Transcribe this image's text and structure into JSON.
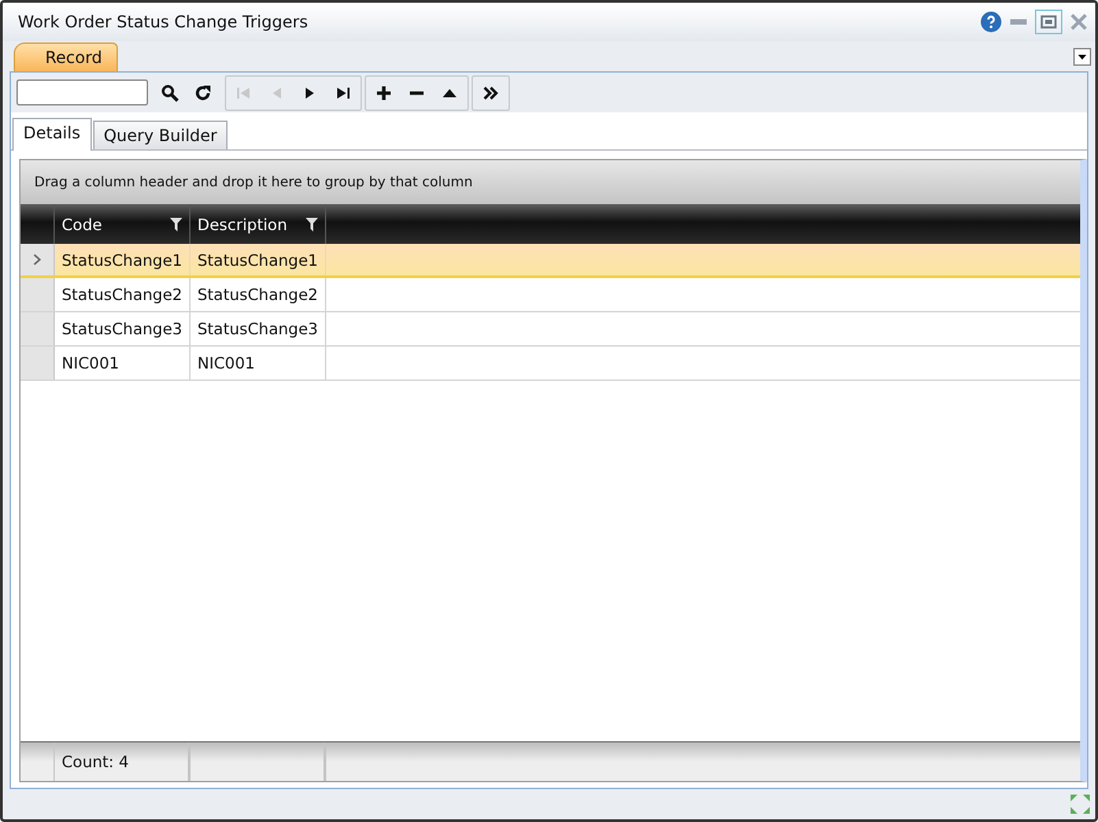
{
  "window": {
    "title": "Work Order Status Change Triggers"
  },
  "ribbon_tabs": [
    {
      "label": "Record",
      "selected": true
    }
  ],
  "toolbar": {
    "buttons": [
      {
        "kind": "search",
        "disabled": false
      },
      {
        "kind": "refresh",
        "disabled": false
      },
      {
        "kind": "first",
        "disabled": true
      },
      {
        "kind": "prev",
        "disabled": true
      },
      {
        "kind": "next",
        "disabled": false
      },
      {
        "kind": "last",
        "disabled": false
      },
      {
        "kind": "add",
        "disabled": false
      },
      {
        "kind": "remove",
        "disabled": false
      },
      {
        "kind": "up",
        "disabled": false
      },
      {
        "kind": "more",
        "disabled": false
      }
    ]
  },
  "tabs": [
    {
      "label": "Details",
      "selected": true
    },
    {
      "label": "Query Builder",
      "selected": false
    }
  ],
  "grid": {
    "group_hint": "Drag a column header and drop it here to group by that column",
    "columns": [
      "Code",
      "Description"
    ],
    "rows": [
      {
        "cells": [
          "StatusChange1",
          "StatusChange1"
        ],
        "selected": true
      },
      {
        "cells": [
          "StatusChange2",
          "StatusChange2"
        ],
        "selected": false
      },
      {
        "cells": [
          "StatusChange3",
          "StatusChange3"
        ],
        "selected": false
      },
      {
        "cells": [
          "NIC001",
          "NIC001"
        ],
        "selected": false
      }
    ],
    "footer": "Count: 4"
  }
}
